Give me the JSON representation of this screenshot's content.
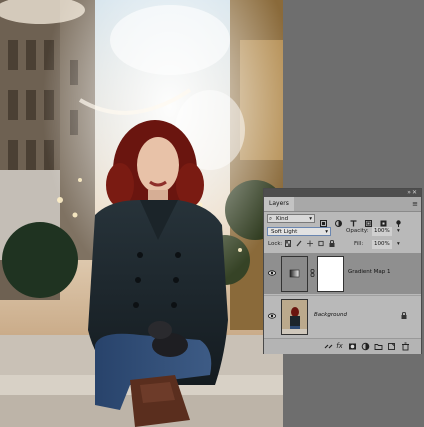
{
  "panel": {
    "tab_label": "Layers",
    "menu_icon": "panel-menu-icon",
    "filter": {
      "kind_label": "Kind",
      "icons": [
        "pixel-filter-icon",
        "adjustment-filter-icon",
        "type-filter-icon",
        "shape-filter-icon",
        "smart-object-filter-icon",
        "filter-toggle-icon"
      ]
    },
    "blend_mode": "Soft Light",
    "opacity_label": "Opacity:",
    "opacity_value": "100%",
    "lock_label": "Lock:",
    "fill_label": "Fill:",
    "fill_value": "100%",
    "layers": [
      {
        "name": "Gradient Map 1",
        "visible": true,
        "selected": true,
        "type": "adjustment"
      },
      {
        "name": "Background",
        "visible": true,
        "selected": false,
        "locked": true
      }
    ],
    "bottom_icons": [
      "link-layers-icon",
      "fx-icon",
      "add-mask-icon",
      "new-adjustment-icon",
      "new-group-icon",
      "new-layer-icon",
      "delete-layer-icon"
    ],
    "fx_label": "fx"
  },
  "colors": {
    "panel_bg": "#b9b9b9",
    "selected_layer": "#8f8f8f",
    "titlebar": "#4e4e4e",
    "workspace": "#6e6e6e"
  }
}
